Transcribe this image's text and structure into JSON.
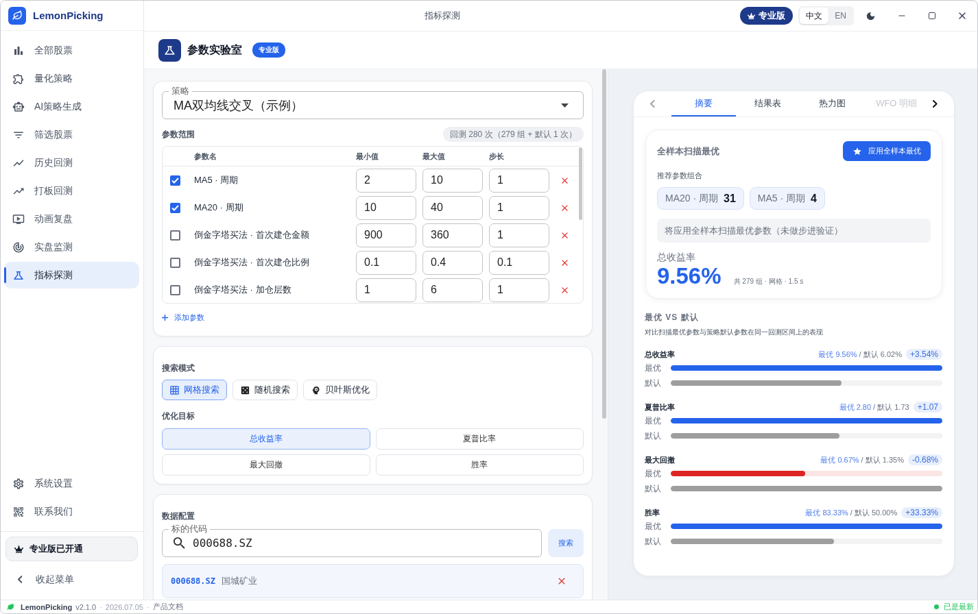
{
  "window": {
    "title": "指标探测"
  },
  "sidebar": {
    "app_name": "LemonPicking",
    "items": [
      {
        "label": "全部股票",
        "selected": false
      },
      {
        "label": "量化策略",
        "selected": false
      },
      {
        "label": "AI策略生成",
        "selected": false
      },
      {
        "label": "筛选股票",
        "selected": false
      },
      {
        "label": "历史回测",
        "selected": false
      },
      {
        "label": "打板回测",
        "selected": false
      },
      {
        "label": "动画复盘",
        "selected": false
      },
      {
        "label": "实盘监测",
        "selected": false
      },
      {
        "label": "指标探测",
        "selected": true
      }
    ],
    "bottom_items": [
      {
        "label": "系统设置",
        "selected": false
      },
      {
        "label": "联系我们",
        "selected": false
      }
    ],
    "pro_status": "专业版已开通",
    "collapse": "收起菜单"
  },
  "header": {
    "pro_badge": "专业版",
    "languages": [
      {
        "label": "中文",
        "selected": true
      },
      {
        "label": "EN",
        "selected": false
      }
    ]
  },
  "page": {
    "title": "参数实验室",
    "badge": "专业版"
  },
  "strategy": {
    "label": "策略",
    "value": "MA双均线交叉（示例）"
  },
  "params": {
    "title": "参数范围",
    "run_count": "回测 280 次（279 组 + 默认 1 次）",
    "columns": [
      "参数名",
      "最小值",
      "最大值",
      "步长"
    ],
    "rows": [
      {
        "name": "MA5 · 周期",
        "checked": true,
        "min": "2",
        "max": "10",
        "step": "1"
      },
      {
        "name": "MA20 · 周期",
        "checked": true,
        "min": "10",
        "max": "40",
        "step": "1"
      },
      {
        "name": "倒金字塔买法 · 首次建仓金额",
        "checked": false,
        "min": "900",
        "max": "360",
        "step": "1"
      },
      {
        "name": "倒金字塔买法 · 首次建仓比例",
        "checked": false,
        "min": "0.1",
        "max": "0.4",
        "step": "0.1"
      },
      {
        "name": "倒金字塔买法 · 加仓层数",
        "checked": false,
        "min": "1",
        "max": "6",
        "step": "1"
      }
    ],
    "add_button": "添加参数"
  },
  "search_mode": {
    "title": "搜索模式",
    "options": [
      {
        "label": "网格搜索",
        "selected": true
      },
      {
        "label": "随机搜索",
        "selected": false
      },
      {
        "label": "贝叶斯优化",
        "selected": false
      }
    ]
  },
  "objective": {
    "title": "优化目标",
    "options": [
      {
        "label": "总收益率",
        "selected": true
      },
      {
        "label": "夏普比率",
        "selected": false
      },
      {
        "label": "最大回撤",
        "selected": false
      },
      {
        "label": "胜率",
        "selected": false
      }
    ]
  },
  "data_config": {
    "title": "数据配置",
    "field": {
      "label": "标的代码",
      "value": "000688.SZ"
    },
    "search_button": "搜索",
    "results": [
      {
        "code": "000688.SZ",
        "name": "国城矿业"
      }
    ]
  },
  "results_panel": {
    "tabs": [
      {
        "label": "摘要",
        "selected": true,
        "disabled": false
      },
      {
        "label": "结果表",
        "selected": false,
        "disabled": false
      },
      {
        "label": "热力图",
        "selected": false,
        "disabled": false
      },
      {
        "label": "WFO 明细",
        "selected": false,
        "disabled": true
      }
    ],
    "best": {
      "title": "全样本扫描最优",
      "apply_button": "应用全样本最优",
      "combo_label": "推荐参数组合",
      "chips": [
        {
          "name": "MA20 · 周期",
          "value": "31"
        },
        {
          "name": "MA5 · 周期",
          "value": "4"
        }
      ],
      "note": "将应用全样本扫描最优参数（未做步进验证）",
      "metric_label": "总收益率",
      "metric_value": "9.56%",
      "meta": "共 279 组 · 网格 · 1.5 s"
    },
    "comparison": {
      "title": "最优 VS 默认",
      "subtitle": "对比扫描最优参数与策略默认参数在同一回测区间上的表现",
      "metrics": [
        {
          "name": "总收益率",
          "best": "最优 9.56%",
          "default": "/ 默认 6.02%",
          "delta": "+3.54%",
          "bars": [
            {
              "label": "最优",
              "level": 1,
              "color": "#2563eb"
            },
            {
              "label": "默认",
              "level": 0.63,
              "color": "#9e9e9e"
            }
          ]
        },
        {
          "name": "夏普比率",
          "best": "最优 2.80",
          "default": "/ 默认 1.73",
          "delta": "+1.07",
          "bars": [
            {
              "label": "最优",
              "level": 1,
              "color": "#2563eb"
            },
            {
              "label": "默认",
              "level": 0.62,
              "color": "#9e9e9e"
            }
          ]
        },
        {
          "name": "最大回撤",
          "best": "最优 0.67%",
          "default": "/ 默认 1.35%",
          "delta": "-0.68%",
          "bars": [
            {
              "label": "最优",
              "level": 0.495,
              "color": "#dc2626"
            },
            {
              "label": "默认",
              "level": 1,
              "color": "#9e9e9e"
            }
          ]
        },
        {
          "name": "胜率",
          "best": "最优 83.33%",
          "default": "/ 默认 50.00%",
          "delta": "+33.33%",
          "bars": [
            {
              "label": "最优",
              "level": 1,
              "color": "#2563eb"
            },
            {
              "label": "默认",
              "level": 0.6,
              "color": "#9e9e9e"
            }
          ]
        }
      ]
    }
  },
  "status_bar": {
    "items": [
      {
        "kind": "brand",
        "text": "LemonPicking"
      },
      {
        "kind": "version",
        "text": "v2.1.0"
      },
      {
        "kind": "sep",
        "text": "·"
      },
      {
        "kind": "date",
        "text": "2026.07.05"
      },
      {
        "kind": "sep",
        "text": "·"
      },
      {
        "kind": "link",
        "text": "产品文档"
      }
    ],
    "update": "已是最新"
  }
}
